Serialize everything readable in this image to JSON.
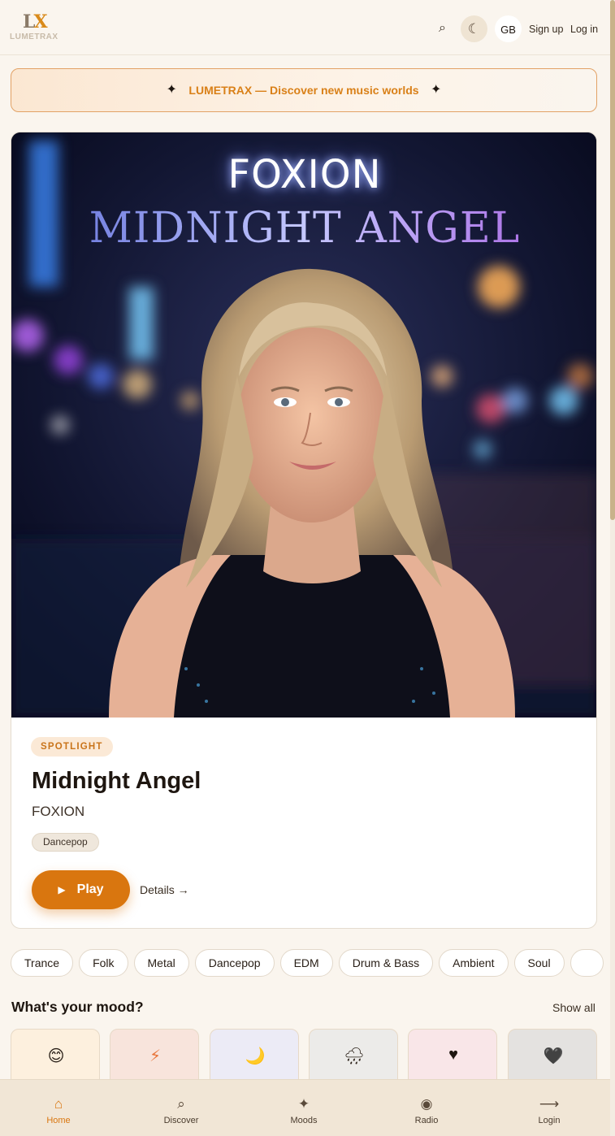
{
  "header": {
    "logo_mark": "LX",
    "logo_text": "LUMETRAX",
    "lang": "GB",
    "signup": "Sign up",
    "login": "Log in",
    "icons": [
      "search-icon",
      "moon-icon"
    ]
  },
  "promo": {
    "text": "LUMETRAX — Discover new music worlds",
    "star": "✦"
  },
  "hero": {
    "cover_artist_text": "FOXION",
    "cover_title_text": "MIDNIGHT ANGEL",
    "badge": "SPOTLIGHT",
    "title": "Midnight Angel",
    "artist": "FOXION",
    "genre": "Dancepop",
    "play_label": "Play",
    "details_label": "Details →"
  },
  "genres": [
    "Trance",
    "Folk",
    "Metal",
    "Dancepop",
    "EDM",
    "Drum & Bass",
    "Ambient",
    "Soul"
  ],
  "mood": {
    "heading": "What's your mood?",
    "show_all": "Show all",
    "cards": [
      {
        "icon": "smiling-face-icon",
        "glyph": "😊",
        "bg": "#fdf0de"
      },
      {
        "icon": "lightning-icon",
        "glyph": "⚡",
        "bg": "#f8e4dc"
      },
      {
        "icon": "crescent-moon-icon",
        "glyph": "🌙",
        "bg": "#ecebf6"
      },
      {
        "icon": "rain-cloud-icon",
        "glyph": "🌧",
        "bg": "#ecebe9"
      },
      {
        "icon": "heart-icon",
        "glyph": "♥",
        "bg": "#f9e6e8"
      },
      {
        "icon": "black-heart-icon",
        "glyph": "🖤",
        "bg": "#e4e2e0"
      }
    ]
  },
  "nav": {
    "items": [
      {
        "label": "Home",
        "icon": "home-icon",
        "glyph": "⌂",
        "active": true
      },
      {
        "label": "Discover",
        "icon": "search-icon",
        "glyph": "⌕",
        "active": false
      },
      {
        "label": "Moods",
        "icon": "sparkle-icon",
        "glyph": "✦",
        "active": false
      },
      {
        "label": "Radio",
        "icon": "radio-icon",
        "glyph": "◉",
        "active": false
      },
      {
        "label": "Login",
        "icon": "arrow-right-icon",
        "glyph": "⟶",
        "active": false
      }
    ]
  },
  "colors": {
    "accent": "#d9760f",
    "background": "#faf5ee",
    "text": "#1e1610"
  }
}
